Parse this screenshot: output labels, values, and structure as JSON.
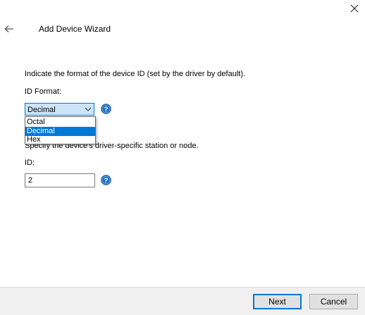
{
  "window": {
    "title": "Add Device Wizard"
  },
  "header": {
    "back_icon": "arrow-left-icon",
    "close_icon": "close-icon"
  },
  "form": {
    "instruction": "Indicate the format of the device ID (set by the driver by default).",
    "id_format_label": "ID Format:",
    "id_format_value": "Decimal",
    "id_format_options": [
      "Octal",
      "Decimal",
      "Hex"
    ],
    "station_instruction": "Specify the device's driver-specific station or node.",
    "id_label": "ID:",
    "id_value": "2",
    "help_icon": "help-icon"
  },
  "footer": {
    "next_label": "Next",
    "cancel_label": "Cancel"
  },
  "colors": {
    "accent": "#0078d7",
    "combo_bg": "#cce4f7",
    "help_blue": "#1e6fbf",
    "footer_bg": "#f0f0f0"
  }
}
